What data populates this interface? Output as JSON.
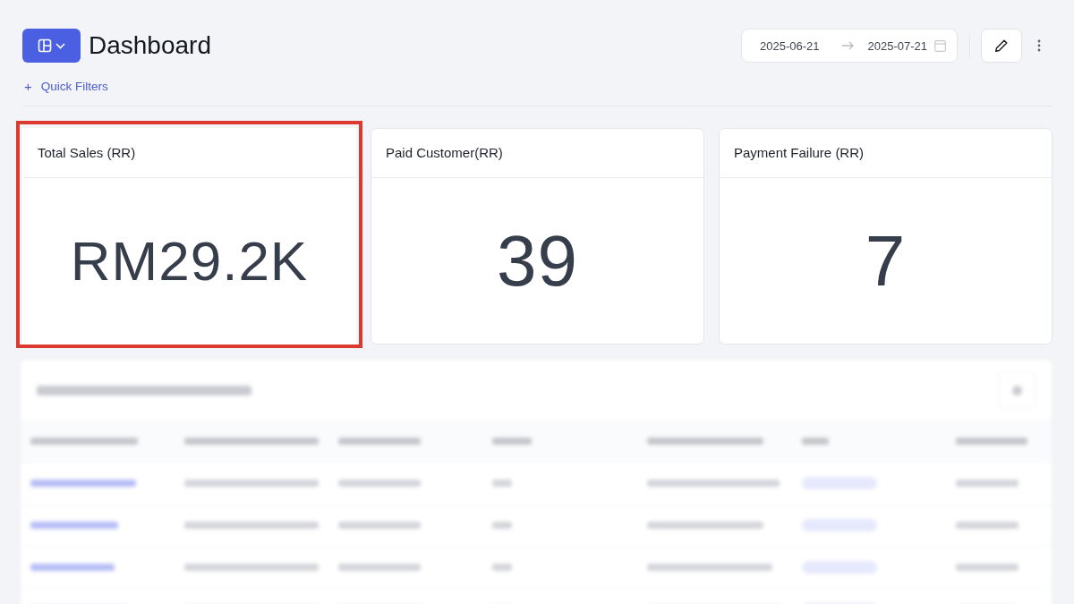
{
  "header": {
    "title": "Dashboard",
    "quick_filters": {
      "icon": "+",
      "label": "Quick Filters"
    },
    "date_range": {
      "start": "2025-06-21",
      "end": "2025-07-21"
    }
  },
  "cards": [
    {
      "title": "Total Sales (RR)",
      "value": "RM29.2K",
      "highlighted": true
    },
    {
      "title": "Paid Customer(RR)",
      "value": "39",
      "highlighted": false
    },
    {
      "title": "Payment Failure (RR)",
      "value": "7",
      "highlighted": false
    }
  ],
  "details_panel": {
    "blurred": true
  }
}
